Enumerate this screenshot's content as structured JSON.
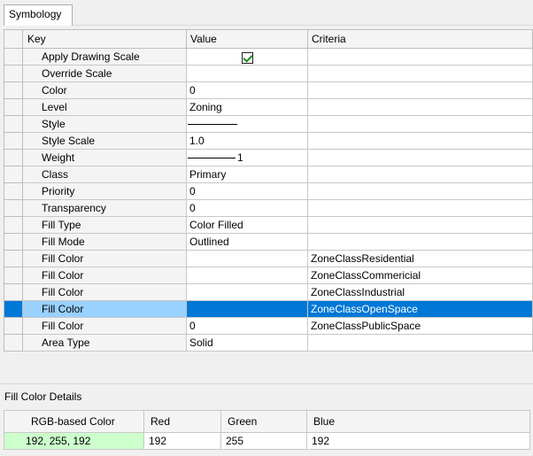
{
  "tab": {
    "label": "Symbology"
  },
  "grid": {
    "columns": {
      "key": "Key",
      "value": "Value",
      "criteria": "Criteria"
    },
    "rows": [
      {
        "key": "Apply Drawing Scale",
        "value": "",
        "criteria": "",
        "checked": true
      },
      {
        "key": "Override Scale",
        "value": "",
        "criteria": ""
      },
      {
        "key": "Color",
        "value": "0",
        "criteria": ""
      },
      {
        "key": "Level",
        "value": "Zoning",
        "criteria": ""
      },
      {
        "key": "Style",
        "value": "",
        "criteria": ""
      },
      {
        "key": "Style Scale",
        "value": "1.0",
        "criteria": ""
      },
      {
        "key": "Weight",
        "value": "1",
        "criteria": ""
      },
      {
        "key": "Class",
        "value": "Primary",
        "criteria": ""
      },
      {
        "key": "Priority",
        "value": "0",
        "criteria": ""
      },
      {
        "key": "Transparency",
        "value": "0",
        "criteria": ""
      },
      {
        "key": "Fill Type",
        "value": "Color Filled",
        "criteria": ""
      },
      {
        "key": "Fill Mode",
        "value": "Outlined",
        "criteria": ""
      },
      {
        "key": "Fill Color",
        "value": "",
        "criteria": "ZoneClassResidential"
      },
      {
        "key": "Fill Color",
        "value": "",
        "criteria": "ZoneClassCommericial"
      },
      {
        "key": "Fill Color",
        "value": "",
        "criteria": "ZoneClassIndustrial"
      },
      {
        "key": "Fill Color",
        "value": "",
        "criteria": "ZoneClassOpenSpace",
        "selected": true
      },
      {
        "key": "Fill Color",
        "value": "0",
        "criteria": "ZoneClassPublicSpace"
      },
      {
        "key": "Area Type",
        "value": "Solid",
        "criteria": ""
      }
    ]
  },
  "details": {
    "title": "Fill Color Details",
    "columns": {
      "rgb": "RGB-based Color",
      "red": "Red",
      "green": "Green",
      "blue": "Blue"
    },
    "row": {
      "rgb": "192, 255, 192",
      "red": "192",
      "green": "255",
      "blue": "192"
    }
  },
  "colors": {
    "selection": "#0078d7",
    "selection_key": "#99d1ff",
    "rgb_swatch": "#c0ffc0",
    "check": "#1a8a1a"
  }
}
